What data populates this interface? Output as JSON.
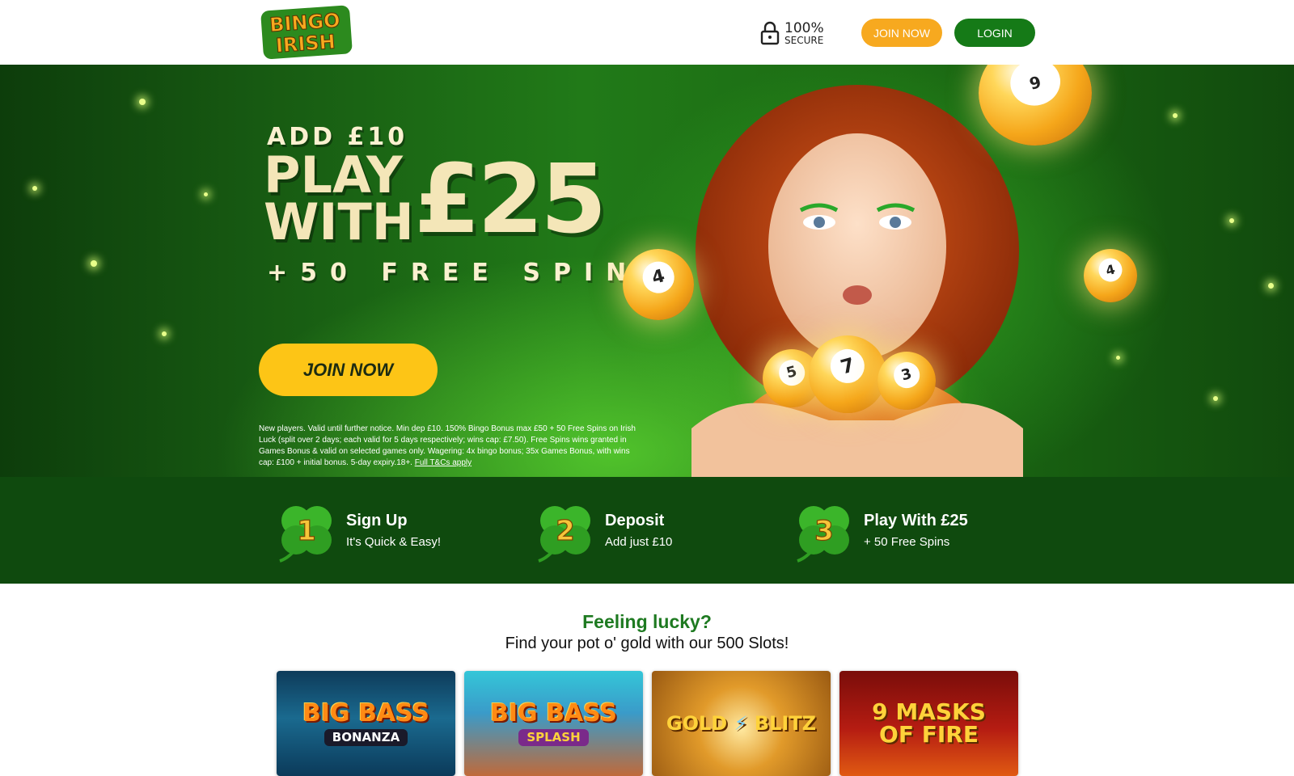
{
  "header": {
    "logo": {
      "line1": "BINGO",
      "line2": "IRISH"
    },
    "secure_pct": "100%",
    "secure_label": "SECURE",
    "join_label": "JOIN NOW",
    "login_label": "LOGIN"
  },
  "hero": {
    "add": "ADD £10",
    "play_line1": "PLAY",
    "play_line2": "WITH",
    "amount": "£25",
    "spins": "+50 FREE SPINS",
    "join_label": "JOIN NOW",
    "terms": "New players. Valid until further notice. Min dep £10. 150% Bingo Bonus max £50 + 50 Free Spins on Irish Luck (split over 2 days; each valid for 5 days respectively; wins cap: £7.50). Free Spins wins granted in Games Bonus & valid on selected games only. Wagering: 4x bingo bonus; 35x Games Bonus, with wins cap: £100 + initial bonus. 5-day expiry.18+.",
    "terms_link": "Full T&Cs apply",
    "balls": [
      "4",
      "5",
      "7",
      "3",
      "9"
    ]
  },
  "steps": [
    {
      "number": "1",
      "title": "Sign Up",
      "subtitle": "It's Quick & Easy!"
    },
    {
      "number": "2",
      "title": "Deposit",
      "subtitle": "Add just £10"
    },
    {
      "number": "3",
      "title": "Play With £25",
      "subtitle": "+ 50 Free Spins"
    }
  ],
  "lucky": {
    "title": "Feeling lucky?",
    "subtitle": "Find your pot o' gold with our 500 Slots!"
  },
  "games": [
    {
      "line1": "BIG BASS",
      "line2": "BONANZA"
    },
    {
      "line1": "BIG BASS",
      "line2": "SPLASH"
    },
    {
      "line1": "GOLD",
      "line2": "BLITZ"
    },
    {
      "line1": "9 MASKS",
      "line2": "OF FIRE"
    }
  ],
  "colors": {
    "brand_green": "#157a17",
    "join_orange": "#f7a91f",
    "hero_cta_yellow": "#fdc516",
    "steps_bg": "#0f4a0e",
    "lucky_green": "#1e7a21"
  }
}
